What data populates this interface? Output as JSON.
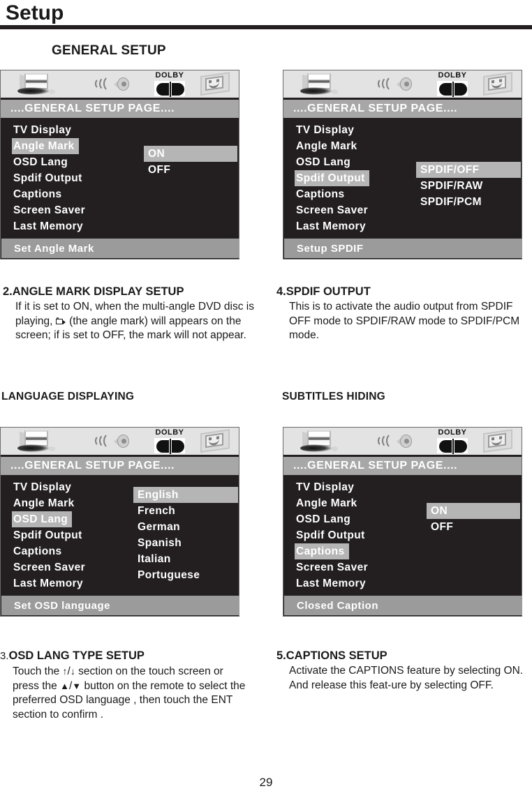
{
  "header": {
    "title": "Setup",
    "section_general": "GENERAL SETUP",
    "section_language": "LANGUAGE DISPLAYING",
    "section_subtitles": "SUBTITLES HIDING"
  },
  "osd_common": {
    "page_bar": "....GENERAL SETUP PAGE....",
    "icons": [
      "tv-monitor-icon",
      "speaker-icon",
      "dolby-digital-icon",
      "sub-picture-icon"
    ],
    "dolby_word": "DOLBY",
    "menu_items": [
      "TV Display",
      "Angle Mark",
      "OSD Lang",
      "Spdif Output",
      "Captions",
      "Screen Saver",
      "Last Memory"
    ]
  },
  "panels": [
    {
      "id": "angle-mark-panel",
      "selected_item": "Angle Mark",
      "options": [
        "ON",
        "OFF"
      ],
      "selected_option": "ON",
      "status": "Set Angle Mark"
    },
    {
      "id": "spdif-panel",
      "selected_item": "Spdif Output",
      "options": [
        "SPDIF/OFF",
        "SPDIF/RAW",
        "SPDIF/PCM"
      ],
      "selected_option": "SPDIF/OFF",
      "status": "Setup SPDIF"
    },
    {
      "id": "osd-lang-panel",
      "selected_item": "OSD Lang",
      "options": [
        "English",
        "French",
        "German",
        "Spanish",
        "Italian",
        "Portuguese"
      ],
      "selected_option": "English",
      "status": "Set OSD language"
    },
    {
      "id": "captions-panel",
      "selected_item": "Captions",
      "options": [
        "ON",
        "OFF"
      ],
      "selected_option": "ON",
      "status": "Closed Caption"
    }
  ],
  "sections": {
    "item2": {
      "number": "2.",
      "title": "ANGLE MARK DISPLAY SETUP",
      "body_before": "If it is set to ON, when the multi-angle DVD disc is playing,",
      "body_after": "(the angle mark) will appears on the screen; if is set to OFF, the mark will not appear."
    },
    "item4": {
      "number": "4.",
      "title": "SPDIF OUTPUT",
      "body": "This is to activate the audio output from SPDIF OFF mode to SPDIF/RAW mode to SPDIF/PCM mode."
    },
    "item3": {
      "number": "3.",
      "title": "OSD LANG TYPE SETUP",
      "body_p1": "Touch the",
      "arrow_up": "↑",
      "slash": "/",
      "arrow_down": "↓",
      "body_p2": "section on the touch screen or press the",
      "arrow_up_big": "▲",
      "arrow_down_big": "▼",
      "body_p3": "button on the remote to select the preferred OSD language , then touch the ENT section to confirm ."
    },
    "item5": {
      "number": "5.",
      "title": "CAPTIONS SETUP",
      "body": "Activate the CAPTIONS feature by selecting ON.  And release this feat-ure by selecting OFF."
    }
  },
  "footer": {
    "page_number": "29"
  }
}
